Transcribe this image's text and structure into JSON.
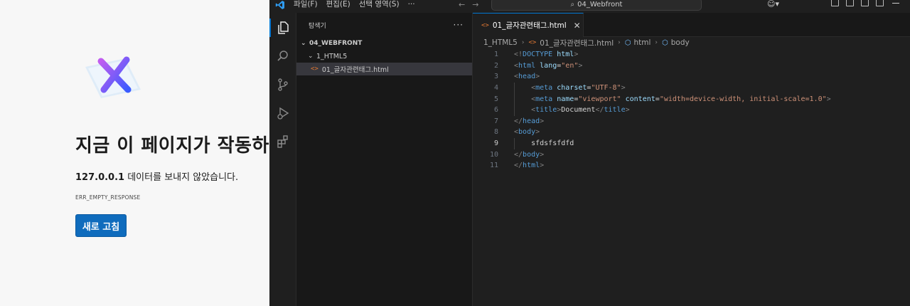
{
  "browser": {
    "title": "지금 이 페이지가 작동하지 않습니다",
    "desc_host": "127.0.0.1",
    "desc_rest": " 데이터를 보내지 않았습니다.",
    "error_code": "ERR_EMPTY_RESPONSE",
    "reload_label": "새로 고침",
    "icon": "error-x-icon"
  },
  "vscode": {
    "menu": [
      "파일(F)",
      "편집(E)",
      "선택 영역(S)",
      "···"
    ],
    "command_center": "04_Webfront",
    "sidebar": {
      "title": "탐색기",
      "root": "04_WEBFRONT",
      "folder": "1_HTML5",
      "file": "01_글자관련태그.html"
    },
    "tab": {
      "label": "01_글자관련태그.html",
      "close": "✕"
    },
    "breadcrumb": [
      "1_HTML5",
      "01_글자관련태그.html",
      "html",
      "body"
    ],
    "line_numbers": [
      "1",
      "2",
      "3",
      "4",
      "5",
      "6",
      "7",
      "8",
      "9",
      "10",
      "11"
    ],
    "current_line": 9,
    "code": {
      "doctype": "DOCTYPE",
      "doctype_kw": "html",
      "html_tag": "html",
      "lang_attr": "lang",
      "lang_val": "\"en\"",
      "head_tag": "head",
      "meta_tag": "meta",
      "charset_attr": "charset",
      "charset_val": "\"UTF-8\"",
      "name_attr": "name",
      "name_val": "\"viewport\"",
      "content_attr": "content",
      "content_val": "\"width=device-width, initial-scale=1.0\"",
      "title_tag": "title",
      "title_text": "Document",
      "body_tag": "body",
      "body_text": "sfdsfsfdfd"
    },
    "colors": {
      "accent": "#0078d4",
      "tag": "#569cd6",
      "attr": "#9cdcfe",
      "string": "#ce9178",
      "button": "#0f6cbd"
    }
  }
}
